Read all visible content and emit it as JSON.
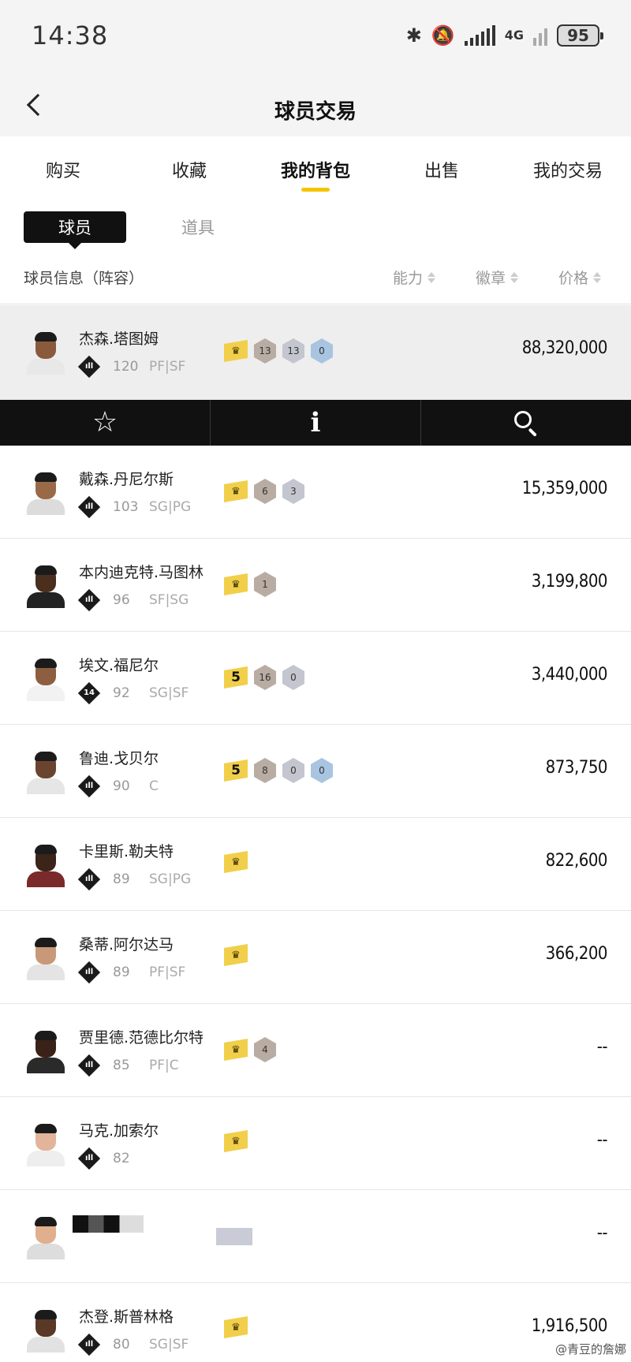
{
  "status": {
    "time": "14:38",
    "network": "4G",
    "battery": "95"
  },
  "header": {
    "title": "球员交易",
    "back_label": "‹"
  },
  "tabs": [
    {
      "label": "购买",
      "active": false
    },
    {
      "label": "收藏",
      "active": false
    },
    {
      "label": "我的背包",
      "active": true
    },
    {
      "label": "出售",
      "active": false
    },
    {
      "label": "我的交易",
      "active": false
    }
  ],
  "segment": {
    "players": "球员",
    "items": "道具"
  },
  "columns": {
    "info": "球员信息（阵容）",
    "ability": "能力",
    "badges": "徽章",
    "price": "价格"
  },
  "players": [
    {
      "name": "杰森.塔图姆",
      "tier": "",
      "ovr": "120",
      "pos": "PF|SF",
      "crown": "crown",
      "badges": [
        {
          "n": "13",
          "t": "bronze"
        },
        {
          "n": "13",
          "t": "silver"
        },
        {
          "n": "0",
          "t": "blue"
        }
      ],
      "price": "88,320,000",
      "skin": "#8a5a3c",
      "jersey": "#e8e8e8"
    },
    {
      "name": "戴森.丹尼尔斯",
      "tier": "",
      "ovr": "103",
      "pos": "SG|PG",
      "crown": "crown",
      "badges": [
        {
          "n": "6",
          "t": "bronze"
        },
        {
          "n": "3",
          "t": "silver"
        }
      ],
      "price": "15,359,000",
      "skin": "#9a6a48",
      "jersey": "#dcdcdc"
    },
    {
      "name": "本内迪克特.马图林",
      "tier": "",
      "ovr": "96",
      "pos": "SF|SG",
      "crown": "crown",
      "badges": [
        {
          "n": "1",
          "t": "bronze"
        }
      ],
      "price": "3,199,800",
      "skin": "#4a2e1e",
      "jersey": "#222222"
    },
    {
      "name": "埃文.福尼尔",
      "tier": "14",
      "ovr": "92",
      "pos": "SG|SF",
      "crown": "5",
      "badges": [
        {
          "n": "16",
          "t": "bronze"
        },
        {
          "n": "0",
          "t": "silver"
        }
      ],
      "price": "3,440,000",
      "skin": "#8e5e40",
      "jersey": "#f2f2f2"
    },
    {
      "name": "鲁迪.戈贝尔",
      "tier": "",
      "ovr": "90",
      "pos": "C",
      "crown": "5",
      "badges": [
        {
          "n": "8",
          "t": "bronze"
        },
        {
          "n": "0",
          "t": "silver"
        },
        {
          "n": "0",
          "t": "blue"
        }
      ],
      "price": "873,750",
      "skin": "#6b4430",
      "jersey": "#e6e6e6"
    },
    {
      "name": "卡里斯.勒夫特",
      "tier": "",
      "ovr": "89",
      "pos": "SG|PG",
      "crown": "crown",
      "badges": [],
      "price": "822,600",
      "skin": "#3b2418",
      "jersey": "#7a2a2a"
    },
    {
      "name": "桑蒂.阿尔达马",
      "tier": "",
      "ovr": "89",
      "pos": "PF|SF",
      "crown": "crown",
      "badges": [],
      "price": "366,200",
      "skin": "#c99878",
      "jersey": "#e4e4e4"
    },
    {
      "name": "贾里德.范德比尔特",
      "tier": "",
      "ovr": "85",
      "pos": "PF|C",
      "crown": "crown",
      "badges": [
        {
          "n": "4",
          "t": "bronze"
        }
      ],
      "price": "--",
      "skin": "#3a2218",
      "jersey": "#2a2a2a"
    },
    {
      "name": "马克.加索尔",
      "tier": "",
      "ovr": "82",
      "pos": "",
      "crown": "crown",
      "badges": [],
      "price": "--",
      "skin": "#e2b49a",
      "jersey": "#eeeeee"
    },
    {
      "name": "",
      "tier": "",
      "ovr": "",
      "pos": "",
      "crown": "",
      "badges": [],
      "price": "--",
      "skin": "#e0b08e",
      "jersey": "#dddddd"
    },
    {
      "name": "杰登.斯普林格",
      "tier": "",
      "ovr": "80",
      "pos": "SG|SF",
      "crown": "crown",
      "badges": [],
      "price": "1,916,500",
      "skin": "#5a3826",
      "jersey": "#e2e2e2"
    }
  ],
  "watermark": "@青豆的詹娜",
  "colors": {
    "accent": "#f5c400",
    "crown": "#f1cf4a",
    "bar": "#111111"
  }
}
